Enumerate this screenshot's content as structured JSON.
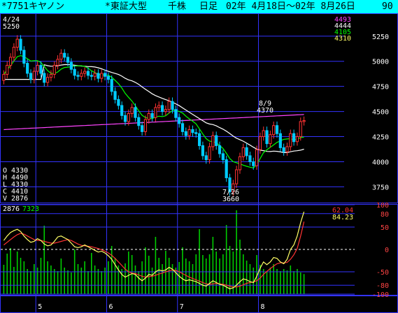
{
  "header": {
    "code_name": "*7751キヤノン",
    "market": "*東証大型",
    "unit": "千株",
    "period_type": "日足",
    "date_range": "02年 4月18日～02年 8月26日",
    "count": "90"
  },
  "chart_data": [
    {
      "type": "candlestick",
      "ylim": [
        3600,
        5450
      ],
      "y_ticks": [
        "5250",
        "5000",
        "4750",
        "4500",
        "4250",
        "4000",
        "3750"
      ],
      "x_ticks": [
        "5",
        "6",
        "7",
        "8"
      ],
      "high_annotation": {
        "date": "4/24",
        "value": "5250"
      },
      "low_annotation": {
        "date": "7/26",
        "value": "3660"
      },
      "mark_annotation": {
        "date": "8/9",
        "value": "4370"
      },
      "ohlcv_box": [
        {
          "label": "O",
          "value": "4330"
        },
        {
          "label": "H",
          "value": "4490"
        },
        {
          "label": "L",
          "value": "4330"
        },
        {
          "label": "C",
          "value": "4410"
        },
        {
          "label": "V",
          "value": "2876"
        }
      ],
      "ma_legend": [
        {
          "value": "4493",
          "color": "#ff44ff"
        },
        {
          "value": "4444",
          "color": "#ffffff"
        },
        {
          "value": "4105",
          "color": "#00ff00"
        },
        {
          "value": "4310",
          "color": "#ffff66"
        }
      ],
      "colors": {
        "up": "#ff3333",
        "down": "#00ccff",
        "ma_long": "#ff44ff",
        "ma_mid": "#ffffff",
        "ma_short": "#00ff00",
        "ma_short2": "#ffff66"
      },
      "closes": [
        4870,
        4960,
        5040,
        5140,
        5220,
        5110,
        4980,
        4880,
        4820,
        4900,
        4960,
        4880,
        4790,
        4840,
        4870,
        4960,
        5020,
        5080,
        5040,
        4990,
        4920,
        4860,
        4850,
        4880,
        4900,
        4860,
        4850,
        4880,
        4830,
        4880,
        4850,
        4820,
        4700,
        4620,
        4560,
        4460,
        4400,
        4480,
        4540,
        4440,
        4360,
        4300,
        4420,
        4480,
        4440,
        4540,
        4560,
        4500,
        4520,
        4600,
        4520,
        4440,
        4380,
        4300,
        4260,
        4320,
        4290,
        4280,
        4160,
        4060,
        4020,
        4150,
        4260,
        4160,
        4080,
        4020,
        3840,
        3700,
        3780,
        3920,
        4050,
        4140,
        4060,
        4000,
        3960,
        4120,
        4250,
        4310,
        4180,
        4270,
        4360,
        4280,
        4140,
        4100,
        4150,
        4280,
        4200,
        4250,
        4400,
        4410
      ]
    },
    {
      "type": "volume",
      "current_volume_label": "2876",
      "volume_ma_label": "7323",
      "volumes": [
        4200,
        5800,
        6600,
        3900,
        6100,
        5200,
        4700,
        3600,
        3300,
        4300,
        3800,
        5200,
        9800,
        4700,
        4100,
        3600,
        3300,
        5100,
        3800,
        3400,
        3100,
        6400,
        4300,
        3800,
        4700,
        3300,
        5900,
        4100,
        3600,
        3300,
        3800,
        4700,
        6900,
        5200,
        4100,
        3600,
        4400,
        6100,
        5600,
        4100,
        3300,
        4700,
        6700,
        5500,
        3800,
        8200,
        5200,
        4300,
        6200,
        5200,
        4300,
        3800,
        4600,
        6700,
        5100,
        4700,
        4300,
        5700,
        9300,
        5600,
        5100,
        5700,
        8200,
        6100,
        5100,
        5700,
        9900,
        6900,
        6100,
        12000,
        7800,
        5700,
        4800,
        4300,
        3800,
        5600,
        4200,
        3600,
        3300,
        3800,
        4300,
        3600,
        3300,
        3600,
        3400,
        4100,
        3300,
        3600,
        3100,
        2876
      ],
      "ma_line": "7323"
    },
    {
      "type": "oscillator",
      "ylim": [
        -100,
        100
      ],
      "y_ticks": [
        "100",
        "80",
        "50",
        "0",
        "-50",
        "-80",
        "-100"
      ],
      "legend": [
        {
          "value": "62.04",
          "color": "#ff3333"
        },
        {
          "value": "84.23",
          "color": "#ffff66"
        }
      ],
      "fast": [
        20,
        30,
        38,
        42,
        45,
        40,
        30,
        22,
        16,
        18,
        24,
        20,
        12,
        8,
        10,
        18,
        28,
        30,
        26,
        22,
        14,
        6,
        4,
        6,
        10,
        6,
        2,
        -2,
        -6,
        -4,
        -8,
        -14,
        -22,
        -34,
        -46,
        -56,
        -62,
        -58,
        -54,
        -56,
        -64,
        -70,
        -64,
        -56,
        -58,
        -50,
        -46,
        -48,
        -46,
        -40,
        -44,
        -52,
        -60,
        -66,
        -70,
        -68,
        -70,
        -72,
        -76,
        -80,
        -82,
        -76,
        -70,
        -74,
        -78,
        -80,
        -84,
        -88,
        -86,
        -80,
        -72,
        -66,
        -68,
        -72,
        -74,
        -60,
        -42,
        -28,
        -34,
        -28,
        -18,
        -20,
        -28,
        -32,
        -22,
        0,
        10,
        30,
        60,
        84.23
      ],
      "slow": [
        10,
        16,
        22,
        28,
        33,
        36,
        34,
        30,
        26,
        22,
        20,
        20,
        18,
        16,
        14,
        14,
        16,
        18,
        20,
        22,
        20,
        16,
        12,
        9,
        8,
        7,
        6,
        4,
        2,
        -1,
        -4,
        -8,
        -13,
        -20,
        -28,
        -36,
        -44,
        -50,
        -53,
        -54,
        -57,
        -60,
        -62,
        -61,
        -60,
        -58,
        -55,
        -53,
        -50,
        -48,
        -46,
        -47,
        -50,
        -54,
        -58,
        -62,
        -65,
        -68,
        -71,
        -74,
        -77,
        -78,
        -77,
        -76,
        -77,
        -78,
        -80,
        -82,
        -84,
        -84,
        -82,
        -79,
        -76,
        -74,
        -73,
        -70,
        -64,
        -56,
        -49,
        -43,
        -37,
        -32,
        -30,
        -30,
        -29,
        -22,
        -12,
        2,
        30,
        62.04
      ]
    }
  ]
}
